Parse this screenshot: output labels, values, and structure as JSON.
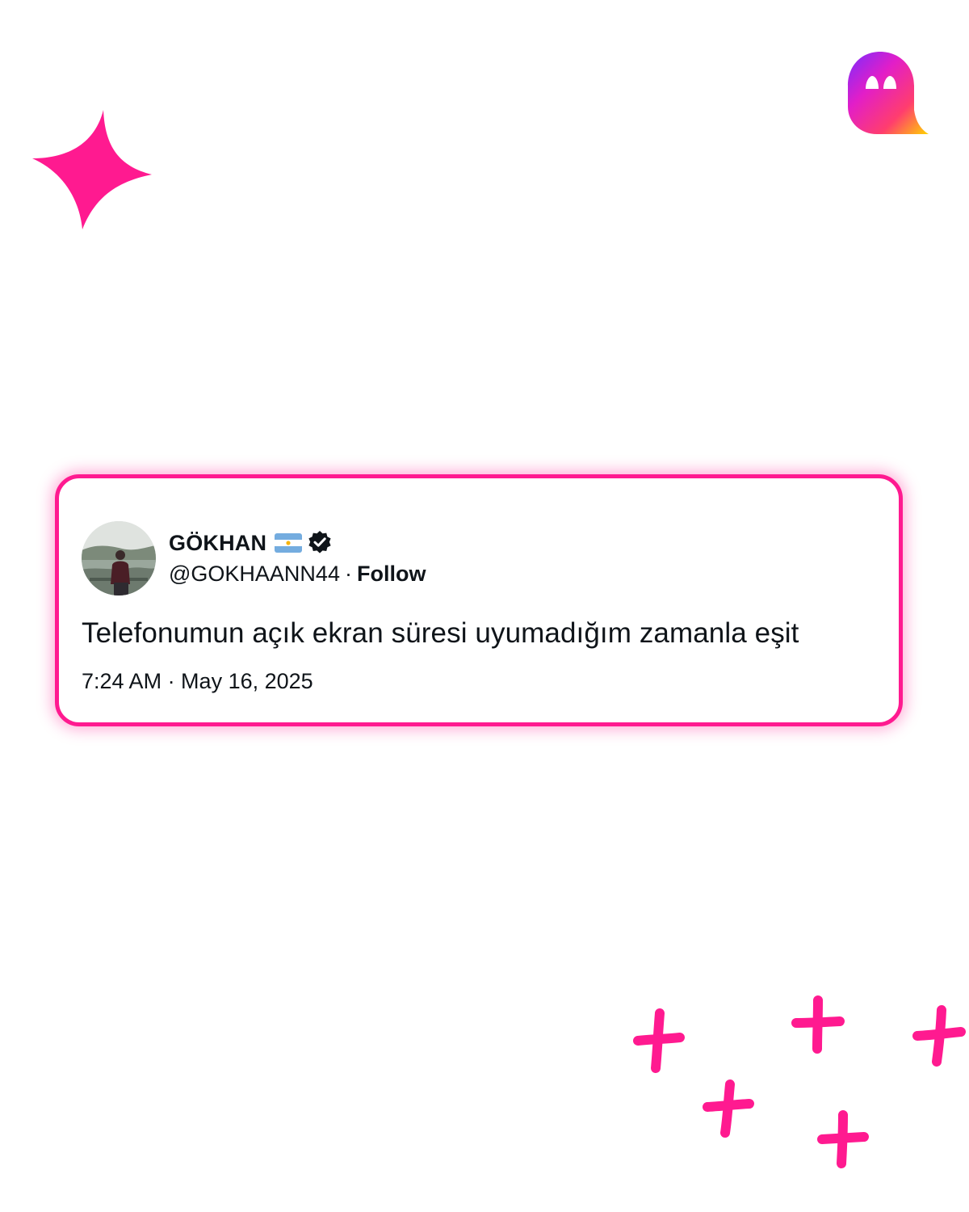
{
  "tweet": {
    "display_name": "GÖKHAN",
    "flag": "argentina-flag",
    "verified": true,
    "handle": "@GOKHAANN44",
    "separator": "·",
    "follow_label": "Follow",
    "text": "Telefonumun açık ekran süresi uyumadığım zamanla eşit",
    "timestamp": "7:24 AM · May 16, 2025"
  },
  "decor": {
    "sparkle": "sparkle-icon",
    "logo": "ghost-logo-icon",
    "plus_marks": [
      "plus-icon",
      "plus-icon",
      "plus-icon",
      "plus-icon",
      "plus-icon"
    ]
  },
  "colors": {
    "accent": "#ff1a90",
    "text": "#0f1419",
    "background": "#ffffff"
  }
}
